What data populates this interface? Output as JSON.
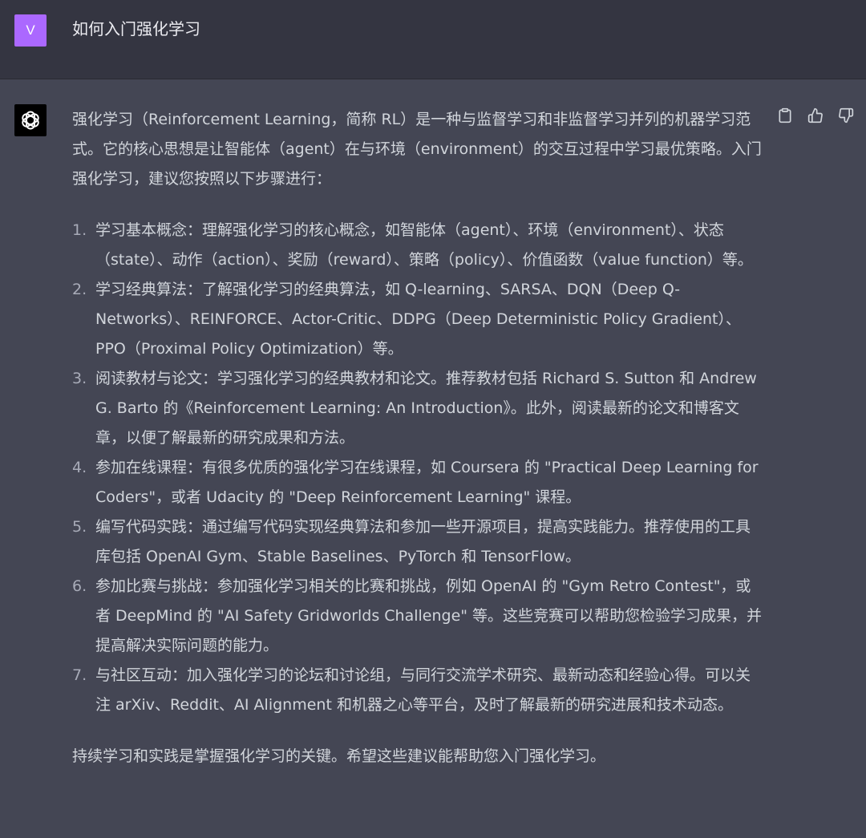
{
  "user_message": {
    "avatar_letter": "V",
    "text": "如何入门强化学习"
  },
  "assistant_message": {
    "avatar_icon": "openai-logo-icon",
    "intro": "强化学习（Reinforcement Learning，简称 RL）是一种与监督学习和非监督学习并列的机器学习范式。它的核心思想是让智能体（agent）在与环境（environment）的交互过程中学习最优策略。入门强化学习，建议您按照以下步骤进行：",
    "steps": [
      {
        "num": "1.",
        "text": "学习基本概念：理解强化学习的核心概念，如智能体（agent）、环境（environment）、状态（state）、动作（action）、奖励（reward）、策略（policy）、价值函数（value function）等。"
      },
      {
        "num": "2.",
        "text": "学习经典算法：了解强化学习的经典算法，如 Q-learning、SARSA、DQN（Deep Q-Networks）、REINFORCE、Actor-Critic、DDPG（Deep Deterministic Policy Gradient）、PPO（Proximal Policy Optimization）等。"
      },
      {
        "num": "3.",
        "text": "阅读教材与论文：学习强化学习的经典教材和论文。推荐教材包括 Richard S. Sutton 和 Andrew G. Barto 的《Reinforcement Learning: An Introduction》。此外，阅读最新的论文和博客文章，以便了解最新的研究成果和方法。"
      },
      {
        "num": "4.",
        "text": "参加在线课程：有很多优质的强化学习在线课程，如 Coursera 的 \"Practical Deep Learning for Coders\"，或者 Udacity 的 \"Deep Reinforcement Learning\" 课程。"
      },
      {
        "num": "5.",
        "text": "编写代码实践：通过编写代码实现经典算法和参加一些开源项目，提高实践能力。推荐使用的工具库包括 OpenAI Gym、Stable Baselines、PyTorch 和 TensorFlow。"
      },
      {
        "num": "6.",
        "text": "参加比赛与挑战：参加强化学习相关的比赛和挑战，例如 OpenAI 的 \"Gym Retro Contest\"，或者 DeepMind 的 \"AI Safety Gridworlds Challenge\" 等。这些竞赛可以帮助您检验学习成果，并提高解决实际问题的能力。"
      },
      {
        "num": "7.",
        "text": "与社区互动：加入强化学习的论坛和讨论组，与同行交流学术研究、最新动态和经验心得。可以关注 arXiv、Reddit、AI Alignment 和机器之心等平台，及时了解最新的研究进展和技术动态。"
      }
    ],
    "outro": "持续学习和实践是掌握强化学习的关键。希望这些建议能帮助您入门强化学习。"
  },
  "actions": [
    {
      "icon": "clipboard-icon"
    },
    {
      "icon": "thumbs-up-icon"
    },
    {
      "icon": "thumbs-down-icon"
    }
  ],
  "colors": {
    "user_bg": "#343541",
    "assistant_bg": "#444654",
    "user_avatar": "#ab68ff",
    "text": "#d1d5db",
    "icon": "#d1d5db"
  }
}
